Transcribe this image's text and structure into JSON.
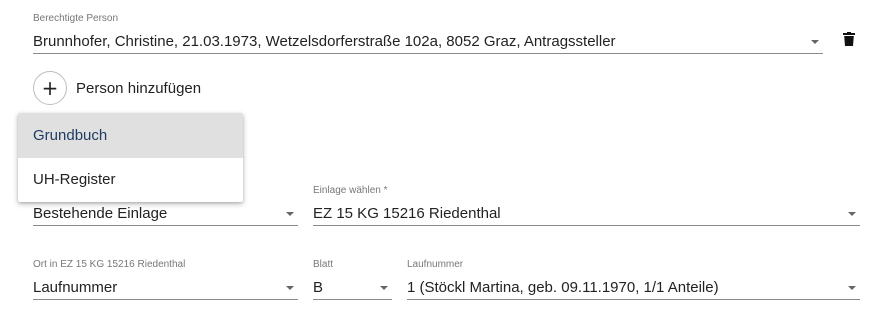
{
  "person": {
    "label": "Berechtigte Person",
    "value": "Brunnhofer, Christine, 21.03.1973, Wetzelsdorferstraße 102a, 8052 Graz, Antragssteller"
  },
  "add_person": {
    "icon": "+",
    "label": "Person hinzufügen"
  },
  "menu": {
    "items": [
      {
        "label": "Grundbuch",
        "selected": true
      },
      {
        "label": "UH-Register",
        "selected": false
      }
    ]
  },
  "einlage_typ": {
    "value": "Bestehende Einlage"
  },
  "einlage": {
    "label": "Einlage wählen *",
    "value": "EZ 15 KG 15216 Riedenthal"
  },
  "ort": {
    "label": "Ort in EZ 15 KG 15216 Riedenthal",
    "value": "Laufnummer"
  },
  "blatt": {
    "label": "Blatt",
    "value": "B"
  },
  "laufnummer": {
    "label": "Laufnummer",
    "value": "1 (Stöckl Martina, geb. 09.11.1970, 1/1 Anteile)"
  },
  "colors": {
    "menu_selected_bg": "#e0e0e0",
    "menu_selected_text": "#1e3a5f",
    "underline": "#8a8a8a"
  }
}
